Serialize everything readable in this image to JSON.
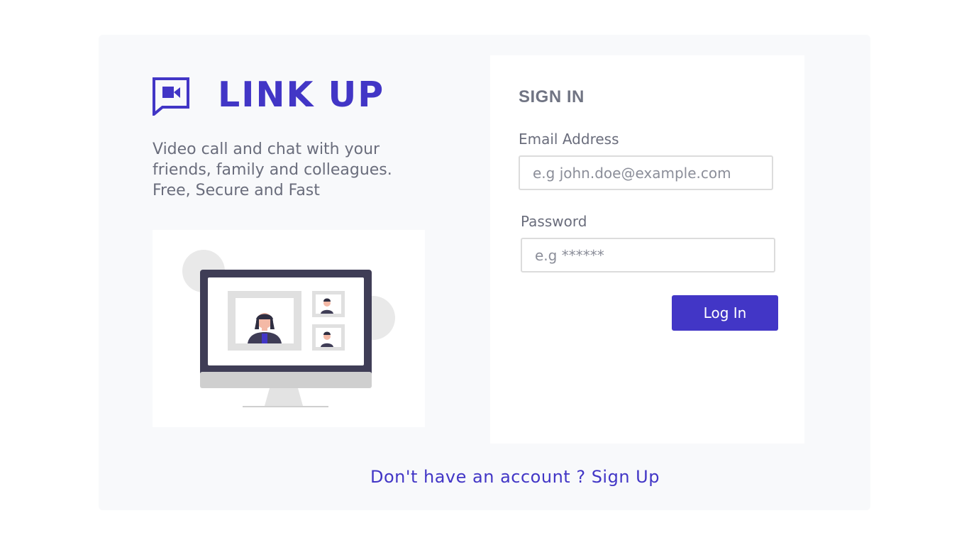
{
  "brand": {
    "name": "LINK UP",
    "icon": "video-chat-icon",
    "color": "#4236c6"
  },
  "tagline": {
    "lines": [
      "Video call and chat with your",
      "friends, family and colleagues.",
      "Free, Secure and Fast"
    ]
  },
  "illustration": {
    "name": "video-call-illustration"
  },
  "signin": {
    "title": "SIGN IN",
    "email_label": "Email Address",
    "email_placeholder": "e.g john.doe@example.com",
    "email_value": "",
    "password_label": "Password",
    "password_placeholder": "e.g ******",
    "password_value": "",
    "login_label": "Log In"
  },
  "footer": {
    "prompt": "Don't have an account ? ",
    "link_label": "Sign Up"
  },
  "colors": {
    "accent": "#4236c6",
    "panel_bg": "#f8f9fb",
    "text_muted": "#6a6d7c"
  }
}
